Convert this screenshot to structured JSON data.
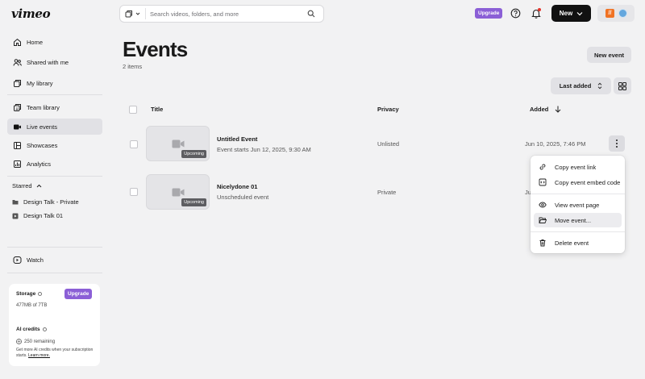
{
  "app": {
    "logo": "vimeo"
  },
  "search": {
    "placeholder": "Search videos, folders, and more"
  },
  "topbar": {
    "upgrade_label": "Upgrade",
    "new_label": "New",
    "team_initial": "//"
  },
  "sidebar": {
    "items": [
      {
        "label": "Home",
        "icon": "home-icon"
      },
      {
        "label": "Shared with me",
        "icon": "people-icon"
      },
      {
        "label": "My library",
        "icon": "library-icon"
      },
      {
        "label": "Team library",
        "icon": "team-library-icon"
      },
      {
        "label": "Live events",
        "icon": "camera-icon",
        "active": true
      },
      {
        "label": "Showcases",
        "icon": "showcase-icon"
      },
      {
        "label": "Analytics",
        "icon": "analytics-icon"
      }
    ],
    "starred_label": "Starred",
    "starred": [
      {
        "label": "Design Talk - Private",
        "icon": "folder-icon"
      },
      {
        "label": "Design Talk 01",
        "icon": "event-icon"
      }
    ],
    "watch_label": "Watch",
    "storage": {
      "label": "Storage",
      "upgrade_label": "Upgrade",
      "used": "477MB of 7TB",
      "ai_label": "AI credits",
      "ai_remaining": "250 remaining",
      "note": "Get more AI credits when your subscription starts.",
      "learn_more": "Learn more."
    }
  },
  "main": {
    "title": "Events",
    "count": "2 items",
    "new_event_label": "New event",
    "sort_label": "Last added",
    "columns": {
      "title": "Title",
      "privacy": "Privacy",
      "added": "Added"
    },
    "events": [
      {
        "title": "Untitled Event",
        "subtitle": "Event starts Jun 12, 2025, 9:30 AM",
        "badge": "Upcoming",
        "privacy": "Unlisted",
        "added": "Jun 10, 2025, 7:46 PM"
      },
      {
        "title": "Nicelydone 01",
        "subtitle": "Unscheduled event",
        "badge": "Upcoming",
        "privacy": "Private",
        "added": "Ju"
      }
    ]
  },
  "menu": {
    "items": [
      {
        "label": "Copy event link",
        "icon": "link-icon"
      },
      {
        "label": "Copy event embed code",
        "icon": "embed-icon"
      },
      {
        "label": "View event page",
        "icon": "eye-icon"
      },
      {
        "label": "Move event...",
        "icon": "folder-open-icon",
        "hover": true
      },
      {
        "label": "Delete event",
        "icon": "trash-icon"
      }
    ]
  },
  "colors": {
    "accent": "#8b5fd6",
    "dark": "#111111",
    "active_bg": "#e1e1e5",
    "background": "#f2f2f3"
  }
}
